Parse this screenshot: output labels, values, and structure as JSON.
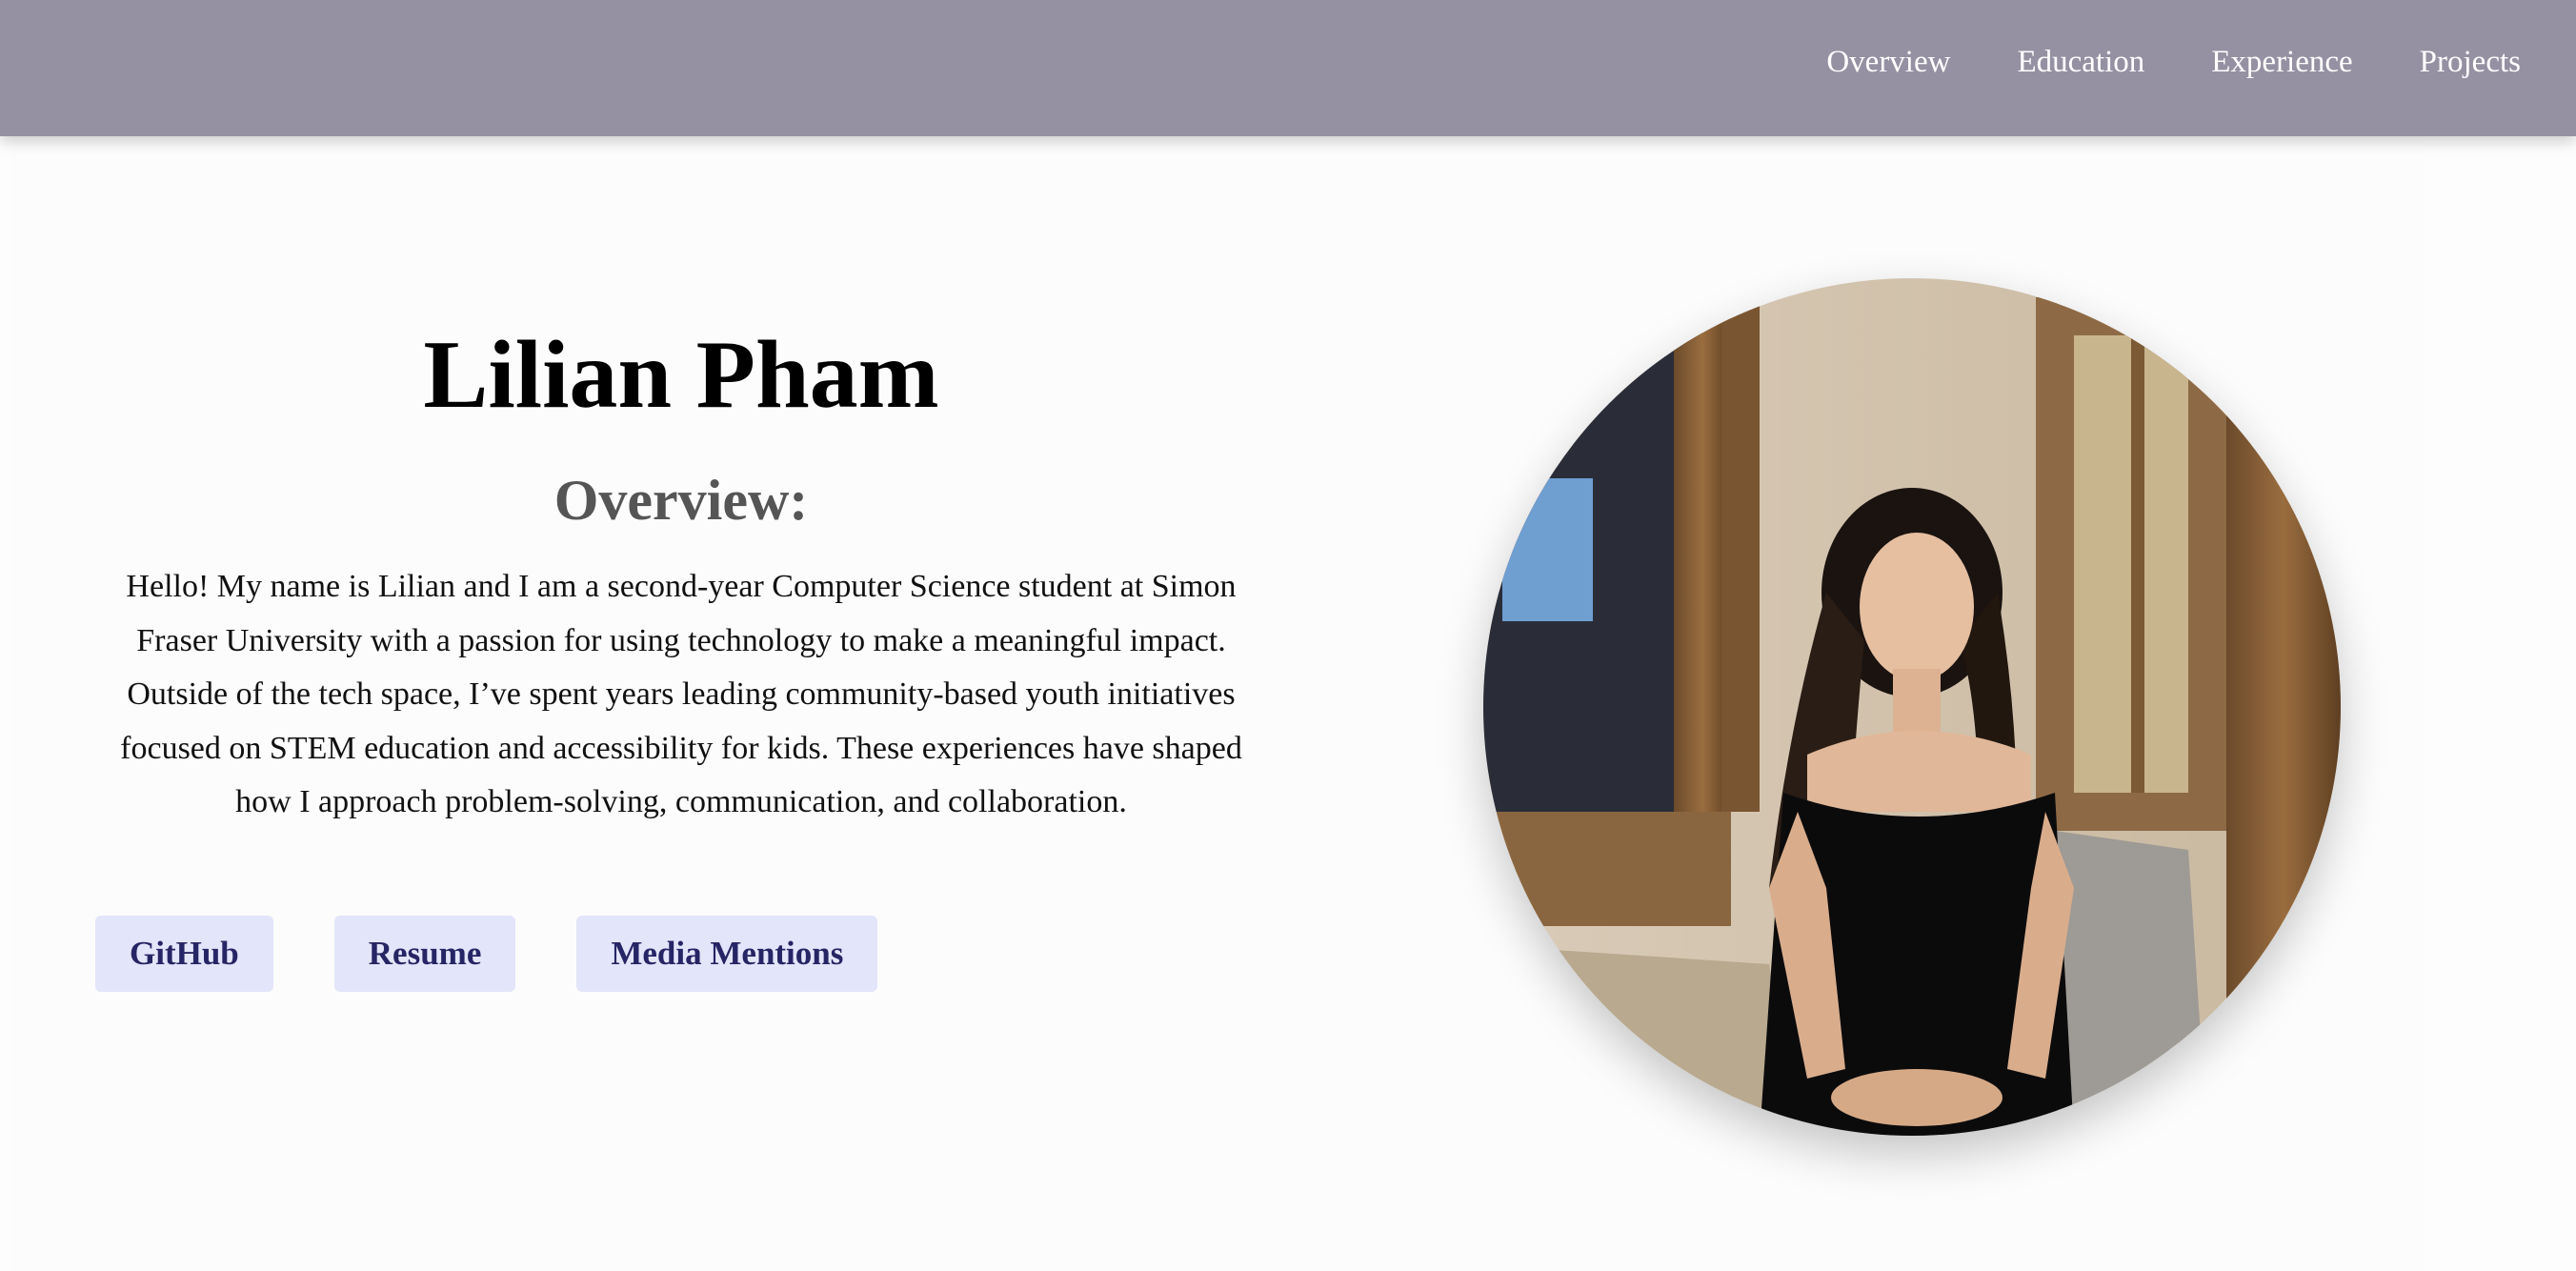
{
  "nav": {
    "links": [
      "Overview",
      "Education",
      "Experience",
      "Projects"
    ]
  },
  "hero": {
    "name": "Lilian Pham",
    "subtitle": "Overview:",
    "bio": "Hello! My name is Lilian and I am a second-year Computer Science student at Simon Fraser University with a passion for using technology to make a meaningful impact. Outside of the tech space, I’ve spent years leading community-based youth initiatives focused on STEM education and accessibility for kids. These experiences have shaped how I approach problem-solving, communication, and collaboration."
  },
  "buttons": {
    "github": "GitHub",
    "resume": "Resume",
    "media": "Media Mentions"
  },
  "colors": {
    "navbar": "#9591a2",
    "button_bg": "#e3e5fa",
    "button_text": "#262565",
    "subtitle": "#555555"
  }
}
